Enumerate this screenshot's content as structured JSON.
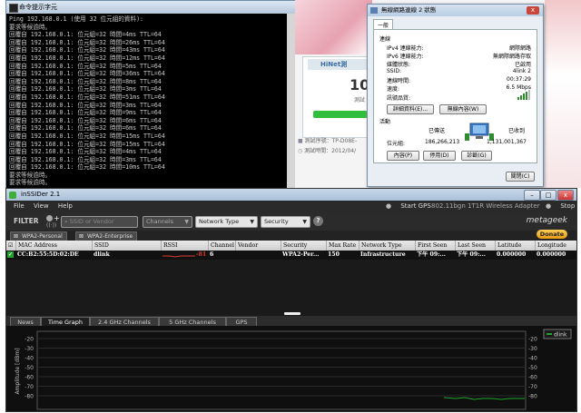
{
  "cmd": {
    "title": "命令提示字元",
    "lines": [
      "Ping 192.168.0.1 (使用 32 位元組的資料):",
      "要求等候逾時。",
      "回覆自 192.168.0.1: 位元組=32 時間=4ms TTL=64",
      "回覆自 192.168.0.1: 位元組=32 時間=26ms TTL=64",
      "回覆自 192.168.0.1: 位元組=32 時間=43ms TTL=64",
      "回覆自 192.168.0.1: 位元組=32 時間=12ms TTL=64",
      "回覆自 192.168.0.1: 位元組=32 時間=5ms TTL=64",
      "回覆自 192.168.0.1: 位元組=32 時間=36ms TTL=64",
      "回覆自 192.168.0.1: 位元組=32 時間=8ms TTL=64",
      "回覆自 192.168.0.1: 位元組=32 時間=3ms TTL=64",
      "回覆自 192.168.0.1: 位元組=32 時間=51ms TTL=64",
      "回覆自 192.168.0.1: 位元組=32 時間=3ms TTL=64",
      "回覆自 192.168.0.1: 位元組=32 時間=9ms TTL=64",
      "回覆自 192.168.0.1: 位元組=32 時間=6ms TTL=64",
      "回覆自 192.168.0.1: 位元組=32 時間=6ms TTL=64",
      "回覆自 192.168.0.1: 位元組=32 時間=15ms TTL=64",
      "回覆自 192.168.0.1: 位元組=32 時間=15ms TTL=64",
      "回覆自 192.168.0.1: 位元組=32 時間=4ms TTL=64",
      "回覆自 192.168.0.1: 位元組=32 時間=3ms TTL=64",
      "回覆自 192.168.0.1: 位元組=32 時間=10ms TTL=64",
      "要求等候逾時。",
      "要求等候逾時。",
      "回覆自 192.168.0.1: 位元組=32 時間=303ms TTL=64",
      "回覆自 192.168.0.1: 位元組=32 時間=18ms TTL=64"
    ]
  },
  "browser": {
    "hinet_title": "HiNet測",
    "speed_value": "10",
    "speed_label": "測試",
    "test_line1": "測試序號：TP-D08E-",
    "test_line2": "測試時間：2012/04/"
  },
  "dialog": {
    "title": "無線網路連線 2 狀態",
    "close": "x",
    "tab": "一般",
    "connection_heading": "連線",
    "ipv4_label": "IPv4 連線能力:",
    "ipv4_value": "網際網路",
    "ipv6_label": "IPv6 連線能力:",
    "ipv6_value": "無網際網路存取",
    "media_label": "媒體狀態:",
    "media_value": "已啟用",
    "ssid_label": "SSID:",
    "ssid_value": "4link 2",
    "duration_label": "連線時間:",
    "duration_value": "00:37:29",
    "speed_label": "速度:",
    "speed_value": "6.5 Mbps",
    "signal_label": "訊號品質:",
    "details_button": "詳細資料(E)...",
    "wireless_button": "無線內容(W)",
    "activity_heading": "活動",
    "sent_label": "已傳送",
    "received_label": "已收到",
    "bytes_label": "位元組:",
    "bytes_sent": "186,266,213",
    "bytes_received": "1,131,001,367",
    "properties_button": "內容(P)",
    "disable_button": "停用(D)",
    "diagnose_button": "診斷(G)",
    "close_button": "關閉(C)"
  },
  "inssider": {
    "title": "inSSIDer 2.1",
    "menu": [
      "File",
      "View",
      "Help"
    ],
    "start_gps": "Start GPS",
    "adapter": "802.11bgn 1T1R Wireless Adapter",
    "stop": "Stop",
    "filter_label": "FILTER",
    "ssid_placeholder": "SSID or Vendor",
    "channels": "Channels",
    "network_type": "Network Type",
    "security": "Security",
    "help": "?",
    "brand": "metageek",
    "tags": [
      "WPA2-Personal",
      "WPA2-Enterprise"
    ],
    "donate": "Donate",
    "columns": [
      "MAC Address",
      "SSID",
      "RSSI",
      "Channel",
      "Vendor",
      "Security",
      "Max Rate",
      "Network Type",
      "First Seen",
      "Last Seen",
      "Latitude",
      "Longitude"
    ],
    "rows": [
      {
        "mac": "CC:B2:55:5D:02:DE",
        "ssid": "dlink",
        "rssi": "-81",
        "channel": "6",
        "vendor": "",
        "security": "WPA2-Per...",
        "max_rate": "150",
        "network_type": "Infrastructure",
        "first_seen": "下午 09:...",
        "last_seen": "下午 09:...",
        "latitude": "0.000000",
        "longitude": "0.000000"
      }
    ],
    "graph_tabs": [
      "News",
      "Time Graph",
      "2.4 GHz Channels",
      "5 GHz Channels",
      "GPS"
    ],
    "active_tab": "Time Graph",
    "y_axis_label": "Amplitude [dBm]",
    "y_ticks": [
      "-20",
      "-30",
      "-40",
      "-50",
      "-60",
      "-70",
      "-80"
    ],
    "legend": "dlink",
    "colors": {
      "accent": "#1fa52b",
      "rssi": "#d93a2b",
      "donate": "#f2b630"
    }
  }
}
